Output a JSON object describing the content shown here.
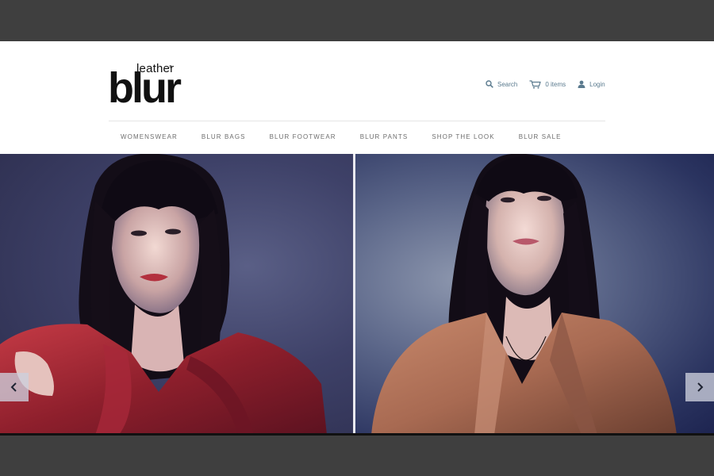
{
  "logo": {
    "small": "leather",
    "big": "blur",
    "reg": "®"
  },
  "utility": [
    {
      "label": "Search",
      "icon": "search-icon"
    },
    {
      "label": "0 items",
      "icon": "cart-icon"
    },
    {
      "label": "Login",
      "icon": "user-icon"
    }
  ],
  "nav": [
    "WOMENSWEAR",
    "BLUR BAGS",
    "BLUR FOOTWEAR",
    "BLUR PANTS",
    "SHOP THE LOOK",
    "BLUR SALE"
  ],
  "colors": {
    "link": "#5a7a8e",
    "nav_text": "#6f6f6f",
    "page_bg": "#3f3f3f",
    "jacket_left": "#8e1f2c",
    "jacket_right": "#a86a52"
  },
  "hero": {
    "prev_icon": "chevron-left-icon",
    "next_icon": "chevron-right-icon"
  }
}
